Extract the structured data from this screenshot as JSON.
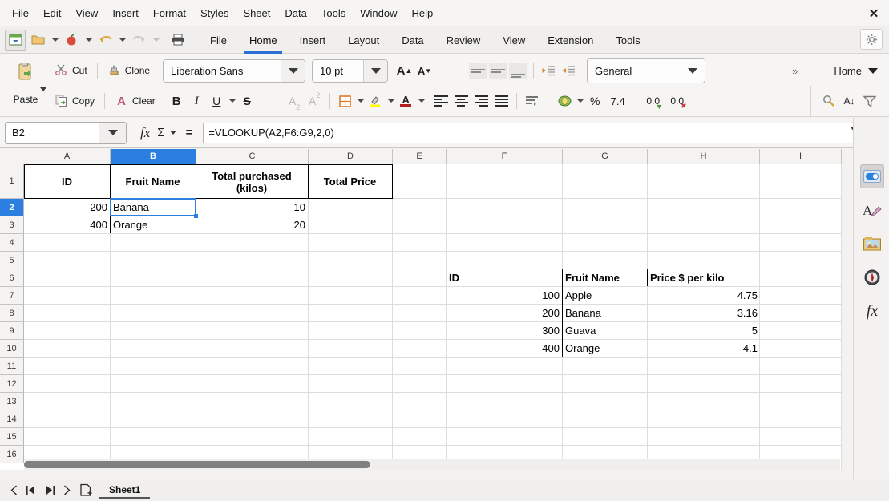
{
  "window": {
    "close_label": "✕"
  },
  "menubar": {
    "items": [
      "File",
      "Edit",
      "View",
      "Insert",
      "Format",
      "Styles",
      "Sheet",
      "Data",
      "Tools",
      "Window",
      "Help"
    ]
  },
  "tabbar": {
    "quick_icons": [
      "start-center-icon",
      "open-icon",
      "save-icon",
      "undo-icon",
      "redo-icon",
      "print-icon"
    ],
    "tabs": [
      "File",
      "Home",
      "Insert",
      "Layout",
      "Data",
      "Review",
      "View",
      "Extension",
      "Tools"
    ],
    "active_tab": "Home",
    "gear_label": "⚙"
  },
  "toolbar": {
    "paste_label": "Paste",
    "cut_label": "Cut",
    "copy_label": "Copy",
    "clone_label": "Clone",
    "clear_label": "Clear",
    "font_name": "Liberation Sans",
    "font_size": "10 pt",
    "grow_font_label": "A",
    "shrink_font_label": "A",
    "bold_label": "B",
    "italic_label": "I",
    "underline_label": "U",
    "strike_label": "S",
    "subscript_label": "A",
    "superscript_label": "A",
    "borders_label": "▦",
    "highlight_label": "✎",
    "fontcolor_label": "A",
    "number_format": "General",
    "percent_label": "%",
    "decimal_label": "7.4",
    "add_decimal_label": "0.0",
    "del_decimal_label": "0.0",
    "overflow_label": "»",
    "mode_label": "Home",
    "find_replace_label": "🔍",
    "sort_label": "A↓",
    "filter_label": "▽"
  },
  "formula_bar": {
    "name_box_value": "B2",
    "function_wizard_label": "fx",
    "sum_label": "Σ",
    "equals_label": "=",
    "formula_value": "=VLOOKUP(A2,F6:G9,2,0)"
  },
  "grid": {
    "columns": [
      "A",
      "B",
      "C",
      "D",
      "E",
      "F",
      "G",
      "H",
      "I"
    ],
    "selected_column": "B",
    "rows": [
      "1",
      "2",
      "3",
      "4",
      "5",
      "6",
      "7",
      "8",
      "9",
      "10",
      "11",
      "12",
      "13",
      "14",
      "15",
      "16"
    ],
    "selected_row": "2",
    "cells": [
      {
        "ref": "A1",
        "col": 0,
        "row": 0,
        "value": "ID",
        "style": "center bold wrap"
      },
      {
        "ref": "B1",
        "col": 1,
        "row": 0,
        "value": "Fruit Name",
        "style": "center bold wrap"
      },
      {
        "ref": "C1",
        "col": 2,
        "row": 0,
        "value": "Total purchased (kilos)",
        "style": "center bold wrap"
      },
      {
        "ref": "D1",
        "col": 3,
        "row": 0,
        "value": "Total Price",
        "style": "center bold wrap"
      },
      {
        "ref": "A2",
        "col": 0,
        "row": 1,
        "value": "200",
        "style": "right"
      },
      {
        "ref": "B2",
        "col": 1,
        "row": 1,
        "value": "Banana",
        "style": "left"
      },
      {
        "ref": "C2",
        "col": 2,
        "row": 1,
        "value": "10",
        "style": "right"
      },
      {
        "ref": "A3",
        "col": 0,
        "row": 2,
        "value": "400",
        "style": "right"
      },
      {
        "ref": "B3",
        "col": 1,
        "row": 2,
        "value": "Orange",
        "style": "left"
      },
      {
        "ref": "C3",
        "col": 2,
        "row": 2,
        "value": "20",
        "style": "right"
      },
      {
        "ref": "F5",
        "col": 5,
        "row": 4,
        "value": "ID",
        "style": "left bold"
      },
      {
        "ref": "G5",
        "col": 6,
        "row": 4,
        "value": "Fruit Name",
        "style": "left bold"
      },
      {
        "ref": "H5",
        "col": 7,
        "row": 4,
        "value": "Price $ per kilo",
        "style": "left bold"
      },
      {
        "ref": "F6",
        "col": 5,
        "row": 5,
        "value": "100",
        "style": "right"
      },
      {
        "ref": "G6",
        "col": 6,
        "row": 5,
        "value": "Apple",
        "style": "left"
      },
      {
        "ref": "H6",
        "col": 7,
        "row": 5,
        "value": "4.75",
        "style": "right"
      },
      {
        "ref": "F7",
        "col": 5,
        "row": 6,
        "value": "200",
        "style": "right"
      },
      {
        "ref": "G7",
        "col": 6,
        "row": 6,
        "value": "Banana",
        "style": "left"
      },
      {
        "ref": "H7",
        "col": 7,
        "row": 6,
        "value": "3.16",
        "style": "right"
      },
      {
        "ref": "F8",
        "col": 5,
        "row": 7,
        "value": "300",
        "style": "right"
      },
      {
        "ref": "G8",
        "col": 6,
        "row": 7,
        "value": "Guava",
        "style": "left"
      },
      {
        "ref": "H8",
        "col": 7,
        "row": 7,
        "value": "5",
        "style": "right"
      },
      {
        "ref": "F9",
        "col": 5,
        "row": 8,
        "value": "400",
        "style": "right"
      },
      {
        "ref": "G9",
        "col": 6,
        "row": 8,
        "value": "Orange",
        "style": "left"
      },
      {
        "ref": "H9",
        "col": 7,
        "row": 8,
        "value": "4.1",
        "style": "right"
      }
    ]
  },
  "sidebar_deck": {
    "icons": [
      "sidebar-settings-icon",
      "properties-icon",
      "styles-icon",
      "gallery-icon",
      "navigator-icon",
      "functions-icon"
    ],
    "active": "properties-icon",
    "functions_label": "fx"
  },
  "bottom": {
    "first_sheet_label": "⏮",
    "prev_sheet_label": "◀",
    "next_sheet_label": "▶",
    "last_sheet_label": "⏭",
    "add_sheet_label": "＋",
    "sheet_name": "Sheet1"
  },
  "colors": {
    "accent": "#2a7fe0",
    "tab_underline": "#2a6fd6",
    "toolbar_bg": "#f6f5f4",
    "grid_line": "#dedddb"
  }
}
